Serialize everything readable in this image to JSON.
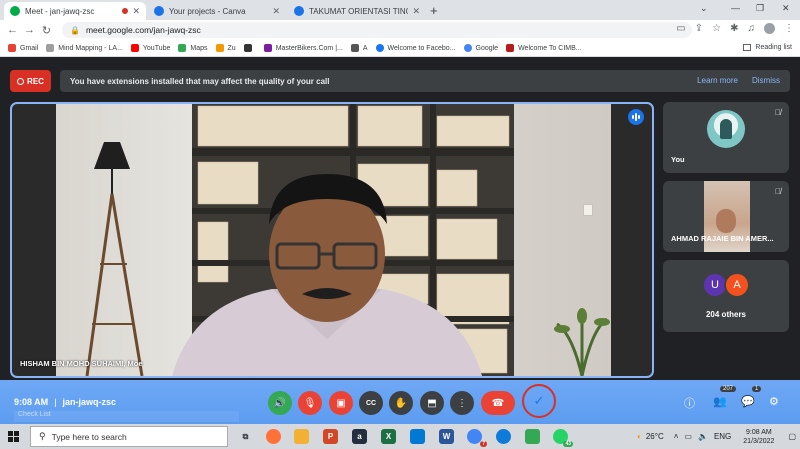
{
  "browser": {
    "tabs": [
      {
        "label": "Meet - jan-jawq-zsc",
        "active": true,
        "favicon_color": "#00ac47"
      },
      {
        "label": "Your projects - Canva",
        "active": false,
        "favicon_color": "#1a73e8"
      },
      {
        "label": "TAKUMAT ORIENTASI TINGKATAN",
        "active": false,
        "favicon_color": "#1a73e8"
      }
    ],
    "new_tab": "+",
    "url": "meet.google.com/jan-jawq-zsc",
    "bookmarks": [
      {
        "label": "Gmail",
        "color": "#ea4335"
      },
      {
        "label": "Mind Mapping - LA...",
        "color": "#9e9e9e"
      },
      {
        "label": "YouTube",
        "color": "#ff0000"
      },
      {
        "label": "Maps",
        "color": "#34a853"
      },
      {
        "label": "Zu",
        "color": "#f29900"
      },
      {
        "label": "",
        "color": "#333333"
      },
      {
        "label": "MasterBikers.Com |...",
        "color": "#7b1fa2"
      },
      {
        "label": "A",
        "color": "#555555"
      },
      {
        "label": "Welcome to Facebo...",
        "color": "#1877f2"
      },
      {
        "label": "Google",
        "color": "#4285f4"
      },
      {
        "label": "Welcome To CIMB...",
        "color": "#b71c1c"
      }
    ],
    "reading_list": "Reading list"
  },
  "meet": {
    "rec_label": "REC",
    "banner_text": "You have extensions installed that may affect the quality of your call",
    "learn_more": "Learn more",
    "dismiss": "Dismiss",
    "main_speaker": "HISHAM BIN MOHD SUHAIMI, Moe",
    "tiles": [
      {
        "name": "You"
      },
      {
        "name": "AHMAD RAJAIE BIN AMER..."
      }
    ],
    "others": {
      "initials": [
        "U",
        "A"
      ],
      "label": "204 others"
    }
  },
  "controls": {
    "time": "9:08 AM",
    "separator": "|",
    "meeting_code": "jan-jawq-zsc",
    "checklist_hint": "Check List",
    "participants_count": "207",
    "chat_count": "1"
  },
  "taskbar": {
    "search_placeholder": "Type here to search",
    "weather": "26°C",
    "language": "ENG",
    "time": "9:08 AM",
    "date": "21/3/2022",
    "badges": {
      "whatsapp": "43",
      "chrome_ext": "7"
    }
  }
}
